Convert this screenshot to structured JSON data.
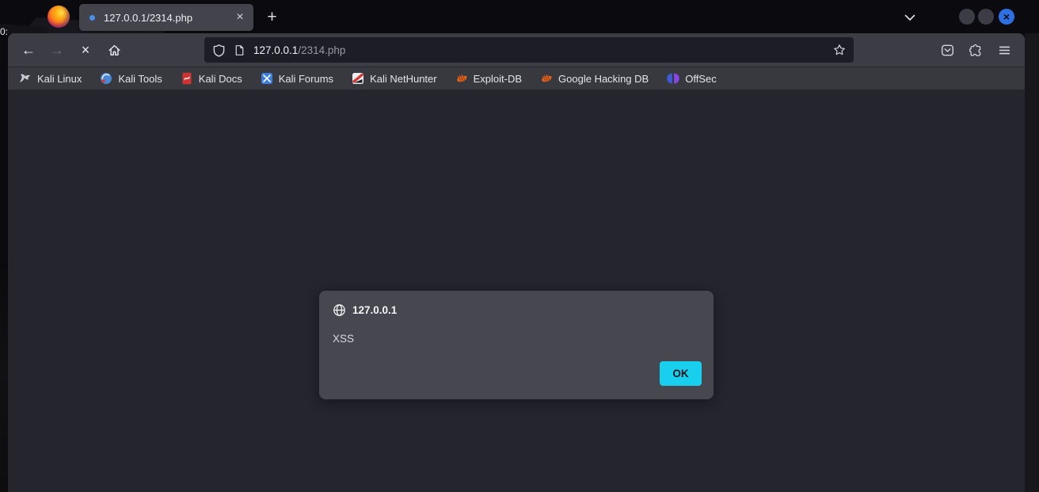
{
  "desktop": {
    "clock_fragment": "0:"
  },
  "titlebar": {
    "tab_title": "127.0.0.1/2314.php"
  },
  "navbar": {
    "url_host": "127.0.0.1",
    "url_path": "/2314.php"
  },
  "bookmarks": [
    {
      "label": "Kali Linux",
      "icon": "kali-dragon-icon"
    },
    {
      "label": "Kali Tools",
      "icon": "kali-tools-icon"
    },
    {
      "label": "Kali Docs",
      "icon": "kali-docs-icon"
    },
    {
      "label": "Kali Forums",
      "icon": "kali-forums-icon"
    },
    {
      "label": "Kali NetHunter",
      "icon": "kali-nethunter-icon"
    },
    {
      "label": "Exploit-DB",
      "icon": "bug-icon"
    },
    {
      "label": "Google Hacking DB",
      "icon": "bug-icon"
    },
    {
      "label": "OffSec",
      "icon": "offsec-icon"
    }
  ],
  "dialog": {
    "origin": "127.0.0.1",
    "message": "XSS",
    "ok_label": "OK"
  },
  "icons": {
    "back": "←",
    "forward": "→",
    "stop": "×",
    "tab_close": "×",
    "new_tab": "+",
    "window_close": "×"
  },
  "colors": {
    "accent_cyan": "#18d0ed",
    "close_button_blue": "#2e6fe4",
    "content_bg": "#25252e",
    "dialog_bg": "#47474f",
    "toolbar_bg": "#3c3c45",
    "urlbar_bg": "#1d1d26",
    "titlebar_bg": "#0b0b0f",
    "tab_bg": "#43434c"
  }
}
